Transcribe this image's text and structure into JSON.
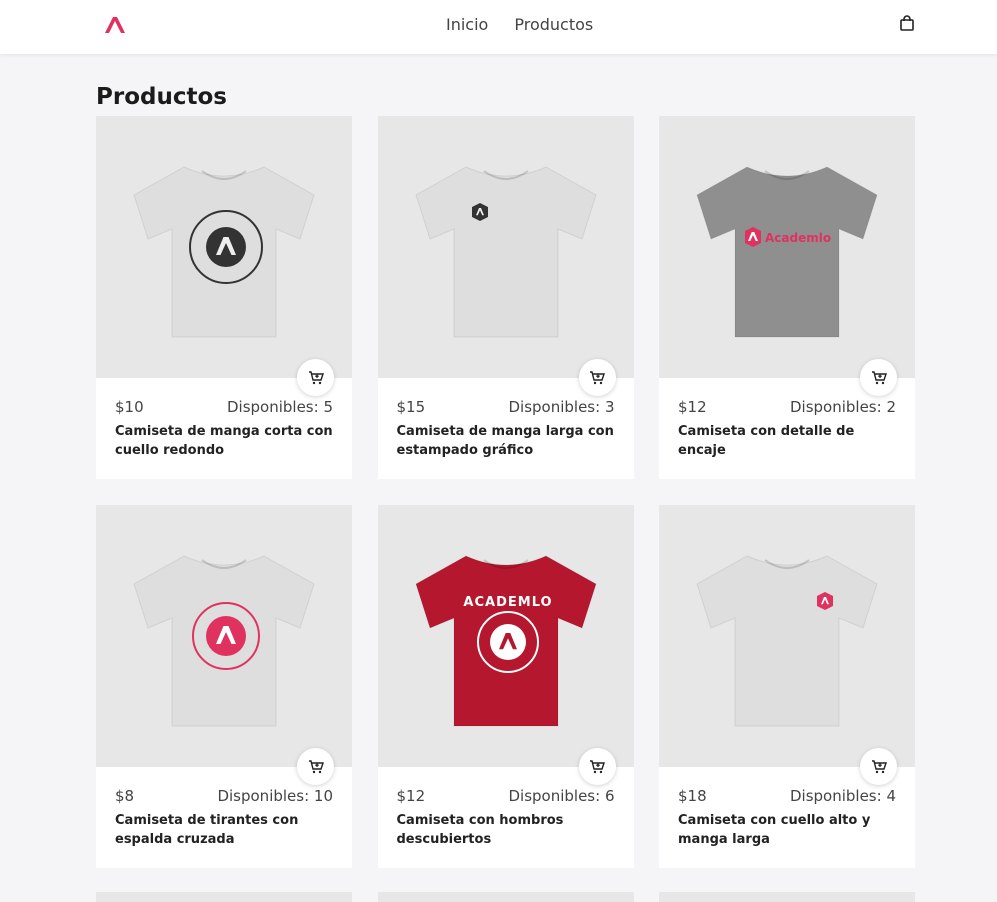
{
  "nav": {
    "links": [
      "Inicio",
      "Productos"
    ],
    "brand_color": "#e0325f"
  },
  "page": {
    "title": "Productos"
  },
  "products": [
    {
      "price": "$10",
      "stock": "Disponibles: 5",
      "name": "Camiseta de manga corta con cuello redondo",
      "shirt_color": "#dedede",
      "print": "circle-dark"
    },
    {
      "price": "$15",
      "stock": "Disponibles: 3",
      "name": "Camiseta de manga larga con estampado gráfico",
      "shirt_color": "#dedede",
      "print": "small-dark"
    },
    {
      "price": "$12",
      "stock": "Disponibles: 2",
      "name": "Camiseta con detalle de encaje",
      "shirt_color": "#8f8f8f",
      "print": "wordmark-pink",
      "print_text": "Academlo"
    },
    {
      "price": "$8",
      "stock": "Disponibles: 10",
      "name": "Camiseta de tirantes con espalda cruzada",
      "shirt_color": "#dedede",
      "print": "circle-pink"
    },
    {
      "price": "$12",
      "stock": "Disponibles: 6",
      "name": "Camiseta con hombros descubiertos",
      "shirt_color": "#b5172e",
      "print": "circle-white",
      "print_text": "ACADEMLO"
    },
    {
      "price": "$18",
      "stock": "Disponibles: 4",
      "name": "Camiseta con cuello alto y manga larga",
      "shirt_color": "#dedede",
      "print": "small-pink"
    }
  ]
}
